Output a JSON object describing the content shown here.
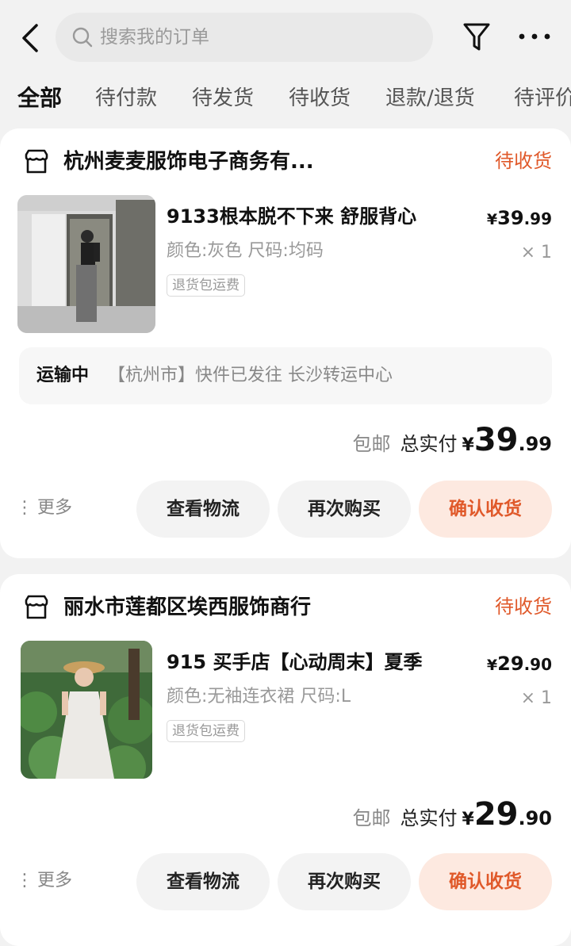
{
  "header": {
    "search_placeholder": "搜索我的订单",
    "icons": [
      "back-icon",
      "search-icon",
      "filter-icon",
      "more-icon"
    ]
  },
  "tabs": [
    "全部",
    "待付款",
    "待发货",
    "待收货",
    "退款/退货",
    "待评价"
  ],
  "active_tab": 0,
  "orders": [
    {
      "shop": "杭州麦麦服饰电子商务有...",
      "status": "待收货",
      "product": "9133根本脱不下来 舒服背心",
      "spec": "颜色:灰色 尺码:均码",
      "tag": "退货包运费",
      "price_currency": "¥",
      "price_int": "39",
      "price_dec": ".99",
      "qty": "× 1",
      "logistics_status": "运输中",
      "logistics_detail": "【杭州市】快件已发往 长沙转运中心",
      "shipping": "包邮",
      "total_label": "总实付",
      "total_currency": "¥",
      "total_int": "39",
      "total_dec": ".99",
      "more": "更多",
      "buttons": [
        "查看物流",
        "再次购买",
        "确认收货"
      ]
    },
    {
      "shop": "丽水市莲都区埃西服饰商行",
      "status": "待收货",
      "product": "915 买手店【心动周末】夏季",
      "spec": "颜色:无袖连衣裙 尺码:L",
      "tag": "退货包运费",
      "price_currency": "¥",
      "price_int": "29",
      "price_dec": ".90",
      "qty": "× 1",
      "shipping": "包邮",
      "total_label": "总实付",
      "total_currency": "¥",
      "total_int": "29",
      "total_dec": ".90",
      "more": "更多",
      "buttons": [
        "查看物流",
        "再次购买",
        "确认收货"
      ]
    }
  ],
  "colors": {
    "accent": "#e0592a",
    "accent_bg": "#fde9e0",
    "page_bg": "#f2f2f2"
  }
}
